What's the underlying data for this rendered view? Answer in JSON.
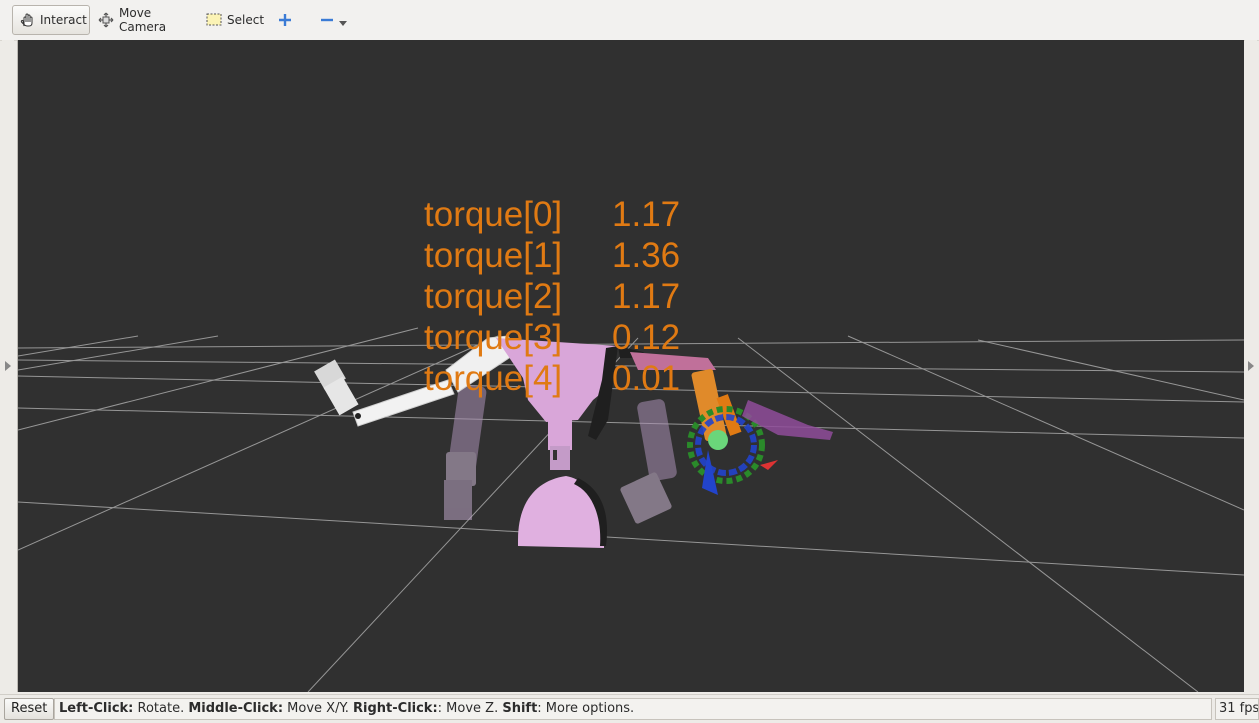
{
  "toolbar": {
    "interact_label": "Interact",
    "move_camera_label": "Move Camera",
    "select_label": "Select"
  },
  "overlay": {
    "rows": [
      {
        "label": "torque[0]",
        "value": "1.17"
      },
      {
        "label": "torque[1]",
        "value": "1.36"
      },
      {
        "label": "torque[2]",
        "value": "1.17"
      },
      {
        "label": "torque[3]",
        "value": "0.12"
      },
      {
        "label": "torque[4]",
        "value": "0.01"
      }
    ],
    "text_color": "#e07a13"
  },
  "statusbar": {
    "reset_label": "Reset",
    "hint": [
      {
        "key": "Left-Click:",
        "desc": " Rotate. "
      },
      {
        "key": "Middle-Click:",
        "desc": " Move X/Y. "
      },
      {
        "key": "Right-Click:",
        "desc": ": Move Z. "
      },
      {
        "key": "Shift",
        "desc": ": More options."
      }
    ],
    "fps": "31 fps"
  },
  "colors": {
    "viewport_bg": "#303030",
    "grid": "#a8a8a8",
    "robot_body": "#d9a6d9",
    "arm_white": "#f2f2f2",
    "accent_blue": "#3a7bd5"
  }
}
